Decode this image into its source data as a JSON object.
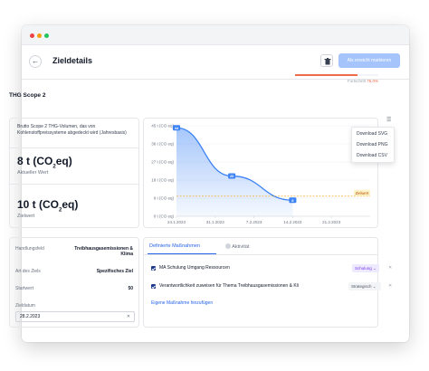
{
  "header": {
    "back_icon": "arrow-left-icon",
    "title": "Zieldetails",
    "trash_icon": "trash-icon",
    "achieve_label": "Als erreicht markieren"
  },
  "progress": {
    "label": "Fortschritt",
    "value_label": "75,0%",
    "value": 75,
    "color": "#ef6a4a"
  },
  "scope_title": "THG Scope 2",
  "metric": {
    "description": "Brutto Scope 2 THG-Volumen, das von Kohlenstoffpreissysteme abgedeckt wird (Jahresbasis)",
    "current_number": "8 t (CO",
    "current_sub": "2",
    "current_unit": "eq)",
    "current_label": "Aktueller Wert",
    "target_number": "10 t (CO",
    "target_sub": "2",
    "target_unit": "eq)",
    "target_label": "Zielwert"
  },
  "chart_data": {
    "type": "area",
    "x": [
      "24.1.2023",
      "3.2.2023",
      "14.2.2023"
    ],
    "y": [
      44,
      20,
      8
    ],
    "point_labels": [
      "44",
      "20",
      "8"
    ],
    "x_ticks": [
      "24.1.2023",
      "31.1.2023",
      "7.2.2023",
      "14.2.2023",
      "21.2.2023"
    ],
    "y_ticks": [
      "45 t (CO eq)",
      "36 t (CO eq)",
      "27 t (CO eq)",
      "18 t (CO eq)",
      "9 t (CO eq)",
      "0 t (CO eq)"
    ],
    "y_values": [
      45,
      36,
      27,
      18,
      9,
      0
    ],
    "ylim": [
      0,
      45
    ],
    "xlim": [
      "24.1.2023",
      "28.2.2023"
    ],
    "target_value": 10,
    "target_label": "Zielwert",
    "grid": true,
    "series_color": "#3b82f6"
  },
  "chart_menu": {
    "icon": "hamburger-menu-icon",
    "items": [
      "Download SVG",
      "Download PNG",
      "Download CSV"
    ]
  },
  "form": {
    "fields": [
      {
        "label": "Handlungsfeld",
        "value": "Treibhausgasemissionen & Klima"
      },
      {
        "label": "Art des Ziels",
        "value": "Spezifisches Ziel"
      },
      {
        "label": "Startwert",
        "value": "50"
      }
    ],
    "date_label": "Zieldatum",
    "date_value": "28.2.2023",
    "clear_icon": "close-icon"
  },
  "measures": {
    "tab_active": "Definierte Maßnahmen",
    "tab_inactive": "Aktivität",
    "tab_inactive_icon": "activity-icon",
    "items": [
      {
        "title": "MA Schulung Umgang Ressourcen",
        "tag": "Schulung",
        "tag_color": "#7c3aed"
      },
      {
        "title": "Verantwortlichkeit zuweisen für Thema Treibhausgasemissionen & Kli",
        "tag": "Strategisch",
        "tag_color": "#4b5563"
      }
    ],
    "add_link": "Eigene Maßnahme hinzufügen"
  }
}
